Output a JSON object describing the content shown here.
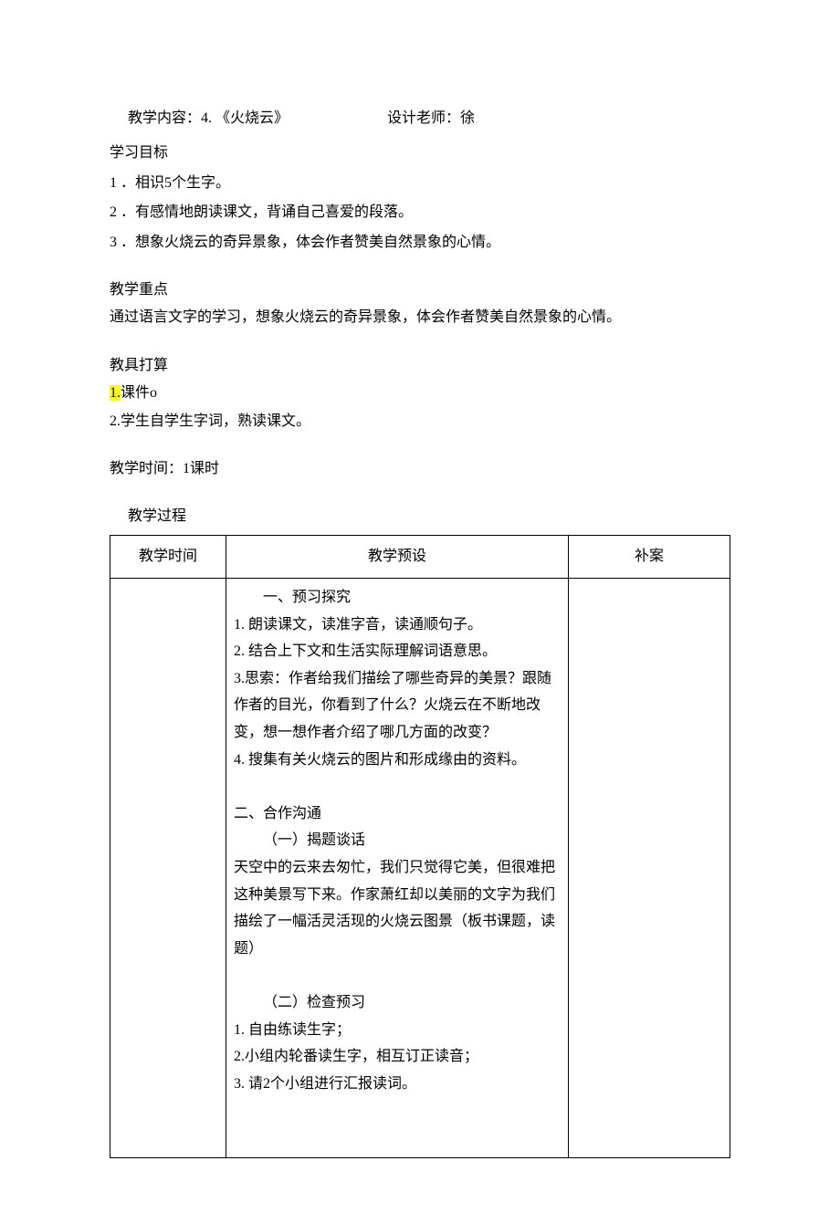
{
  "header": {
    "content_label": "教学内容：",
    "content_value": "4. 《火烧云》",
    "designer_label": "设计老师：",
    "designer_value": "徐"
  },
  "goals": {
    "title": "学习目标",
    "items": [
      "1 ．相识5个生字。",
      "2 ．有感情地朗读课文，背诵自己喜爱的段落。",
      "3 ．想象火烧云的奇异景象，体会作者赞美自然景象的心情。"
    ]
  },
  "focus": {
    "title": "教学重点",
    "body": "通过语言文字的学习，想象火烧云的奇异景象，体会作者赞美自然景象的心情。"
  },
  "tools": {
    "title": "教具打算",
    "item1_prefix": "1.",
    "item1_rest": "课件o",
    "item2": "2.学生自学生字词，熟读课文。"
  },
  "time": {
    "label": "教学时间：",
    "value": "1课时"
  },
  "process": {
    "title": "教学过程",
    "columns": [
      "教学时间",
      "教学预设",
      "补案"
    ],
    "rows": [
      {
        "time": "",
        "plan_lines": [
          {
            "text": "一、预习探究",
            "indent": true
          },
          {
            "text": "1. 朗读课文，读准字音，读通顺句子。",
            "indent": false
          },
          {
            "text": "2. 结合上下文和生活实际理解词语意思。",
            "indent": false
          },
          {
            "text": "3.思索：作者给我们描绘了哪些奇异的美景？跟随作者的目光，你看到了什么？火烧云在不断地改变，想一想作者介绍了哪几方面的改变？",
            "indent": false
          },
          {
            "text": "4. 搜集有关火烧云的图片和形成缘由的资料。",
            "indent": false
          },
          {
            "text": "",
            "indent": false,
            "blank": true
          },
          {
            "text": "二、合作沟通",
            "indent": false
          },
          {
            "text": "（一）揭题谈话",
            "indent": true
          },
          {
            "text": "天空中的云来去匆忙，我们只觉得它美，但很难把这种美景写下来。作家萧红却以美丽的文字为我们描绘了一幅活灵活现的火烧云图景（板书课题，读题）",
            "indent": false
          },
          {
            "text": "",
            "indent": false,
            "blank": true
          },
          {
            "text": "（二）检查预习",
            "indent": true
          },
          {
            "text": "1. 自由练读生字；",
            "indent": false
          },
          {
            "text": "2.小组内轮番读生字，相互订正读音；",
            "indent": false
          },
          {
            "text": "3. 请2个小组进行汇报读词。",
            "indent": false
          },
          {
            "text": "",
            "indent": false,
            "blank": true
          },
          {
            "text": "",
            "indent": false,
            "blank": true
          }
        ],
        "supp": ""
      }
    ]
  }
}
